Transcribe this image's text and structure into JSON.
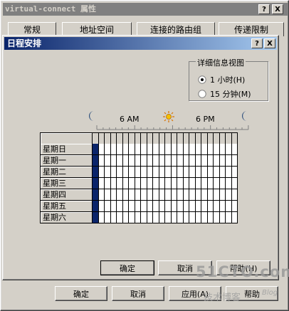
{
  "outer_window": {
    "title": "virtual-connect 属性",
    "help_glyph": "?",
    "close_glyph": "X",
    "tabs": [
      "常规",
      "地址空间",
      "连接的路由组",
      "传递限制"
    ],
    "buttons": {
      "ok": "确定",
      "cancel": "取消",
      "apply": "应用(A)",
      "help": "帮助"
    }
  },
  "schedule_dialog": {
    "title": "日程安排",
    "help_glyph": "?",
    "close_glyph": "X",
    "detail_view": {
      "legend": "详细信息视图",
      "options": [
        {
          "label": "1 小时(H)",
          "selected": true
        },
        {
          "label": "15 分钟(M)",
          "selected": false
        }
      ]
    },
    "timeline": {
      "label_6am": "6 AM",
      "label_6pm": "6 PM"
    },
    "days": [
      "星期日",
      "星期一",
      "星期二",
      "星期三",
      "星期四",
      "星期五",
      "星期六"
    ],
    "hour_count": 24,
    "selected_hour_column": 0,
    "buttons": {
      "ok": "确定",
      "cancel": "取消",
      "help": "帮助(H)"
    }
  },
  "watermark": {
    "line1": "51CTO.com",
    "line2": "技术博客",
    "line3": "Blog"
  },
  "colors": {
    "title_active": "#0a246a",
    "title_inactive": "#808080",
    "face": "#d4d0c8",
    "selection": "#0a246a"
  }
}
